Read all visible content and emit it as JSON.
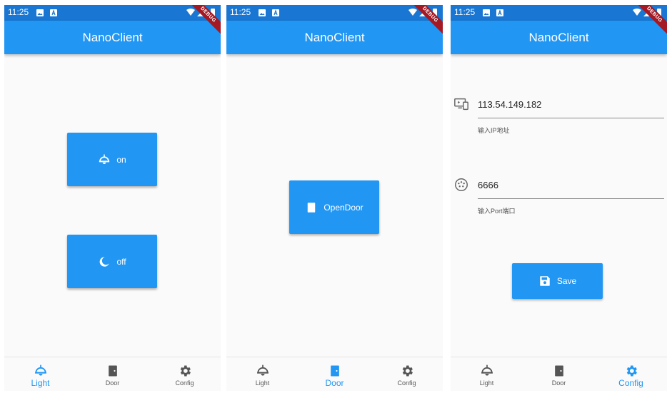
{
  "status": {
    "time": "11:25"
  },
  "app": {
    "title": "NanoClient",
    "debug_label": "DEBUG"
  },
  "light": {
    "on_label": "on",
    "off_label": "off"
  },
  "door": {
    "open_label": "OpenDoor"
  },
  "config": {
    "ip_value": "113.54.149.182",
    "ip_hint": "输入IP地址",
    "port_value": "6666",
    "port_hint": "输入Port端口",
    "save_label": "Save"
  },
  "nav": {
    "light": "Light",
    "door": "Door",
    "config": "Config"
  },
  "colors": {
    "primary": "#2196f3",
    "status_bar": "#1976d2",
    "background": "#fafafa",
    "debug_banner": "#a31924"
  }
}
